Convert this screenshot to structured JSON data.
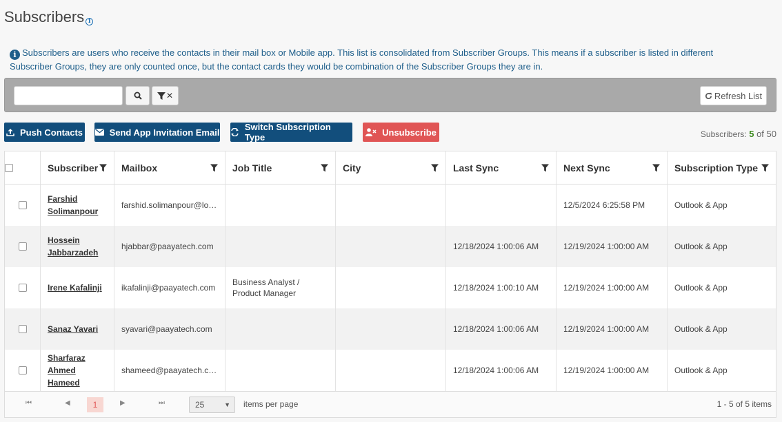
{
  "page": {
    "title": "Subscribers",
    "notice": "Subscribers are users who receive the contacts in their mail box or Mobile app. This list is consolidated from Subscriber Groups. This means if a subscriber is listed in different Subscriber Groups, they are only counted once, but the contact cards they would be combination of the Subscriber Groups they are in."
  },
  "toolbar": {
    "search_value": "",
    "refresh_label": "Refresh List"
  },
  "actions": {
    "push": "Push Contacts",
    "invite": "Send App Invitation Email",
    "switch": "Switch Subscription Type",
    "unsubscribe": "Unsubscribe"
  },
  "count": {
    "label": "Subscribers:",
    "shown": "5",
    "of": "of 50"
  },
  "grid": {
    "columns": [
      "Subscriber",
      "Mailbox",
      "Job Title",
      "City",
      "Last Sync",
      "Next Sync",
      "Subscription Type"
    ],
    "rows": [
      {
        "subscriber": "Farshid Solimanpour",
        "mailbox": "farshid.solimanpour@lotra...",
        "job": "",
        "city": "",
        "last": "",
        "next": "12/5/2024 6:25:58 PM",
        "type": "Outlook & App"
      },
      {
        "subscriber": "Hossein Jabbarzadeh",
        "mailbox": "hjabbar@paayatech.com",
        "job": "",
        "city": "",
        "last": "12/18/2024 1:00:06 AM",
        "next": "12/19/2024 1:00:00 AM",
        "type": "Outlook & App"
      },
      {
        "subscriber": "Irene Kafalinji",
        "mailbox": "ikafalinji@paayatech.com",
        "job": "Business Analyst / Product Manager",
        "city": "",
        "last": "12/18/2024 1:00:10 AM",
        "next": "12/19/2024 1:00:00 AM",
        "type": "Outlook & App"
      },
      {
        "subscriber": "Sanaz Yavari",
        "mailbox": "syavari@paayatech.com",
        "job": "",
        "city": "",
        "last": "12/18/2024 1:00:06 AM",
        "next": "12/19/2024 1:00:00 AM",
        "type": "Outlook & App"
      },
      {
        "subscriber": "Sharfaraz Ahmed Hameed",
        "mailbox": "shameed@paayatech.com",
        "job": "",
        "city": "",
        "last": "12/18/2024 1:00:06 AM",
        "next": "12/19/2024 1:00:00 AM",
        "type": "Outlook & App"
      }
    ]
  },
  "pager": {
    "current_page": "1",
    "page_size": "25",
    "items_per_page_label": "items per page",
    "info": "1 - 5 of 5 items"
  },
  "colors": {
    "primary": "#124e7c",
    "danger": "#e05555",
    "toolbar_bg": "#a9a9a9"
  }
}
